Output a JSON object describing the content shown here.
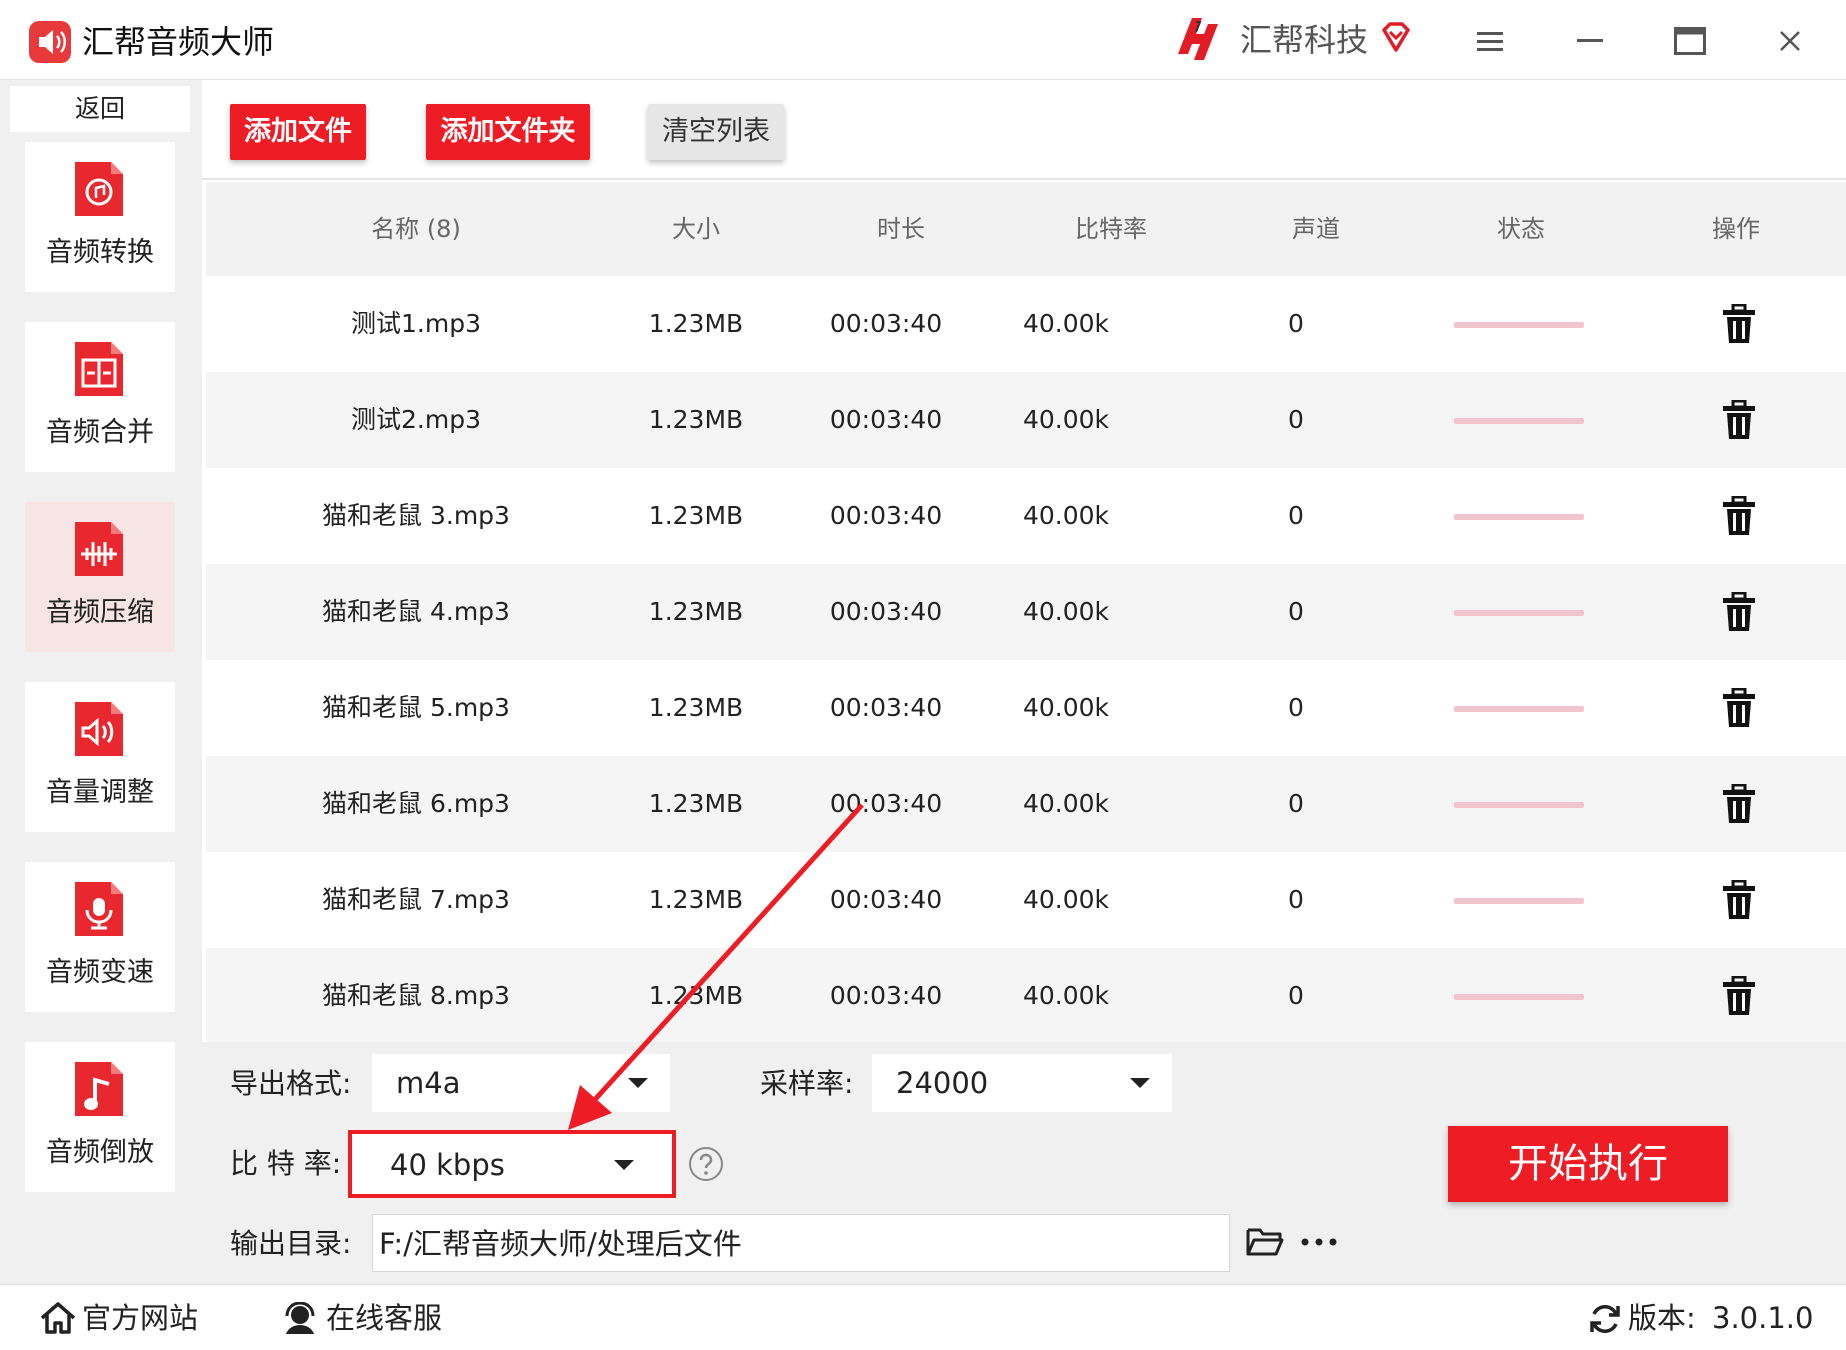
{
  "window": {
    "app_title": "汇帮音频大师",
    "brand_name": "汇帮科技"
  },
  "sidebar": {
    "back_label": "返回",
    "items": [
      {
        "label": "音频转换",
        "icon": "audio-convert-icon"
      },
      {
        "label": "音频合并",
        "icon": "audio-merge-icon"
      },
      {
        "label": "音频压缩",
        "icon": "audio-compress-icon",
        "active": true
      },
      {
        "label": "音量调整",
        "icon": "volume-adjust-icon"
      },
      {
        "label": "音频变速",
        "icon": "audio-speed-icon"
      },
      {
        "label": "音频倒放",
        "icon": "audio-reverse-icon"
      }
    ]
  },
  "toolbar": {
    "add_file_label": "添加文件",
    "add_folder_label": "添加文件夹",
    "clear_list_label": "清空列表"
  },
  "table": {
    "headers": [
      "名称 (8)",
      "大小",
      "时长",
      "比特率",
      "声道",
      "状态",
      "操作"
    ],
    "rows": [
      {
        "name": "测试1.mp3",
        "size": "1.23MB",
        "duration": "00:03:40",
        "bitrate": "40.00k",
        "channels": "0",
        "progress": 0
      },
      {
        "name": "测试2.mp3",
        "size": "1.23MB",
        "duration": "00:03:40",
        "bitrate": "40.00k",
        "channels": "0",
        "progress": 0
      },
      {
        "name": "猫和老鼠 3.mp3",
        "size": "1.23MB",
        "duration": "00:03:40",
        "bitrate": "40.00k",
        "channels": "0",
        "progress": 0
      },
      {
        "name": "猫和老鼠 4.mp3",
        "size": "1.23MB",
        "duration": "00:03:40",
        "bitrate": "40.00k",
        "channels": "0",
        "progress": 0
      },
      {
        "name": "猫和老鼠 5.mp3",
        "size": "1.23MB",
        "duration": "00:03:40",
        "bitrate": "40.00k",
        "channels": "0",
        "progress": 0
      },
      {
        "name": "猫和老鼠 6.mp3",
        "size": "1.23MB",
        "duration": "00:03:40",
        "bitrate": "40.00k",
        "channels": "0",
        "progress": 0
      },
      {
        "name": "猫和老鼠 7.mp3",
        "size": "1.23MB",
        "duration": "00:03:40",
        "bitrate": "40.00k",
        "channels": "0",
        "progress": 0
      },
      {
        "name": "猫和老鼠 8.mp3",
        "size": "1.23MB",
        "duration": "00:03:40",
        "bitrate": "40.00k",
        "channels": "0",
        "progress": 0
      }
    ]
  },
  "settings": {
    "format_label": "导出格式:",
    "format_value": "m4a",
    "samplerate_label": "采样率:",
    "samplerate_value": "24000",
    "bitrate_label": "比 特 率:",
    "bitrate_value": "40 kbps",
    "outdir_label": "输出目录:",
    "outdir_value": "F:/汇帮音频大师/处理后文件",
    "start_label": "开始执行"
  },
  "footer": {
    "website_label": "官方网站",
    "support_label": "在线客服",
    "version_label": "版本:",
    "version_value": "3.0.1.0"
  },
  "colors": {
    "accent": "#ee1c24",
    "active_nav_bg": "#f7e4e4",
    "progress_track": "#f3c4d0"
  }
}
